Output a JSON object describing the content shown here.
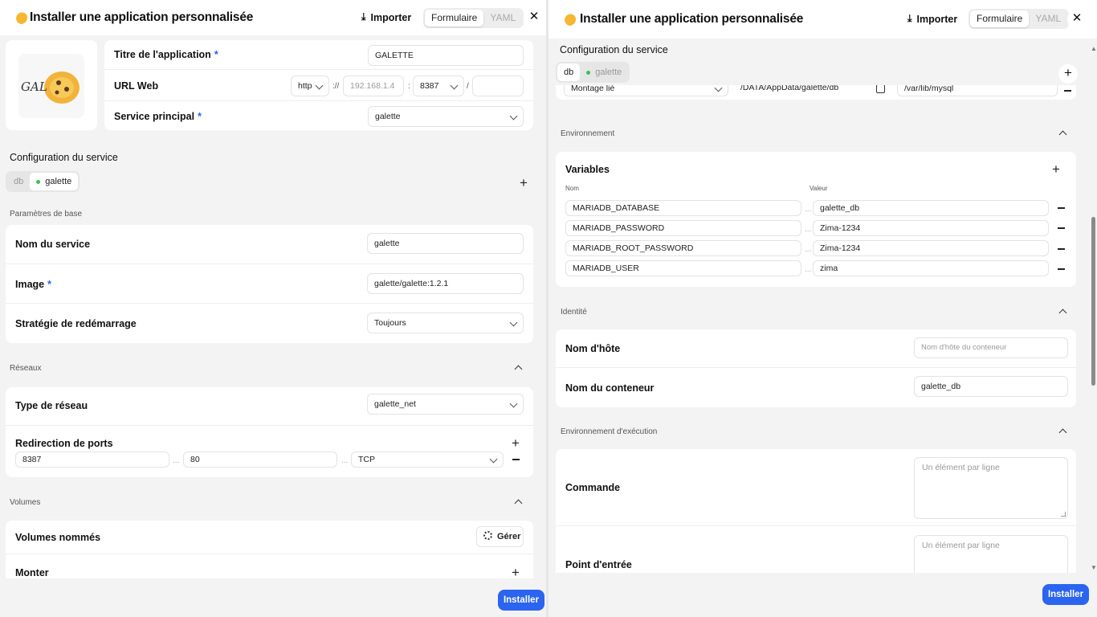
{
  "left": {
    "header": {
      "title": "Installer une application personnalisée",
      "import_label": "Importer",
      "tab_form": "Formulaire",
      "tab_yaml": "YAML"
    },
    "app": {
      "title_label": "Titre de l'application",
      "title_value": "GALETTE",
      "url_label": "URL Web",
      "protocol": "http",
      "sep1": "://",
      "host_placeholder": "192.168.1.4",
      "sep2": ":",
      "port": "8387",
      "sep3": "/",
      "path_value": "",
      "main_service_label": "Service principal",
      "main_service_value": "galette"
    },
    "service_config_title": "Configuration du service",
    "service_tabs": [
      "db",
      "galette"
    ],
    "base_params": {
      "section_title": "Paramètres de base",
      "name_label": "Nom du service",
      "name_value": "galette",
      "image_label": "Image",
      "image_value": "galette/galette:1.2.1",
      "restart_label": "Stratégie de redémarrage",
      "restart_value": "Toujours"
    },
    "networks": {
      "section_title": "Réseaux",
      "type_label": "Type de réseau",
      "type_value": "galette_net",
      "ports_label": "Redirection de ports",
      "host_port": "8387",
      "container_port": "80",
      "protocol": "TCP",
      "sep": "..."
    },
    "volumes": {
      "section_title": "Volumes",
      "named_label": "Volumes nommés",
      "manage_label": "Gérer",
      "mount_label": "Monter"
    },
    "install_label": "Installer"
  },
  "right": {
    "header": {
      "title": "Installer une application personnalisée",
      "import_label": "Importer",
      "tab_form": "Formulaire",
      "tab_yaml": "YAML"
    },
    "service_config_title": "Configuration du service",
    "service_tabs": [
      "db",
      "galette"
    ],
    "mount_row": {
      "type": "Montage lié",
      "source": "/DATA/AppData/galette/db",
      "target": "/var/lib/mysql"
    },
    "environment": {
      "section_title": "Environnement",
      "variables_label": "Variables",
      "col_name": "Nom",
      "col_value": "Valeur",
      "sep": "...",
      "vars": [
        {
          "name": "MARIADB_DATABASE",
          "value": "galette_db"
        },
        {
          "name": "MARIADB_PASSWORD",
          "value": "Zima-1234"
        },
        {
          "name": "MARIADB_ROOT_PASSWORD",
          "value": "Zima-1234"
        },
        {
          "name": "MARIADB_USER",
          "value": "zima"
        }
      ]
    },
    "identity": {
      "section_title": "Identité",
      "hostname_label": "Nom d'hôte",
      "hostname_placeholder": "Nom d'hôte du conteneur",
      "container_label": "Nom du conteneur",
      "container_value": "galette_db"
    },
    "runtime": {
      "section_title": "Environnement d'exécution",
      "command_label": "Commande",
      "command_placeholder": "Un élément par ligne",
      "entrypoint_label": "Point d'entrée",
      "entrypoint_placeholder": "Un élément par ligne"
    },
    "install_label": "Installer"
  }
}
